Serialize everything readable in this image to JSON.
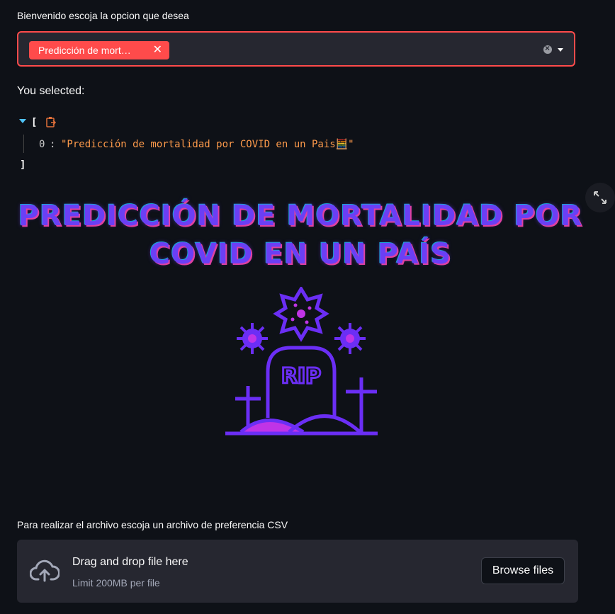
{
  "selector": {
    "label": "Bienvenido escoja la opcion que desea",
    "selected_tag": "Predicción de mort…",
    "tag_close_glyph": "✕"
  },
  "output": {
    "heading": "You selected:",
    "json_open": "[",
    "json_close": "]",
    "item_index": "0",
    "item_colon": ":",
    "item_value": "\"Predicción de mortalidad por COVID en un Pais🧮\""
  },
  "banner": {
    "title_line1": "PREDICCIÓN DE MORTALIDAD POR",
    "title_line2": "COVID EN UN PAÍS",
    "illustration_text": "RIP"
  },
  "uploader": {
    "label": "Para realizar el archivo escoja un archivo de preferencia CSV",
    "drop_title": "Drag and drop file here",
    "drop_limit": "Limit 200MB per file",
    "browse_label": "Browse files"
  },
  "colors": {
    "accent": "#ff4b4b",
    "background": "#0e1117",
    "panel": "#262730",
    "json_value": "#fd9a4b",
    "illustration_purple": "#6b2ef5",
    "illustration_magenta": "#c034e6"
  },
  "icons": [
    "clipboard-icon",
    "expand-icon",
    "cloud-upload-icon",
    "clear-icon",
    "chevron-down-icon"
  ]
}
